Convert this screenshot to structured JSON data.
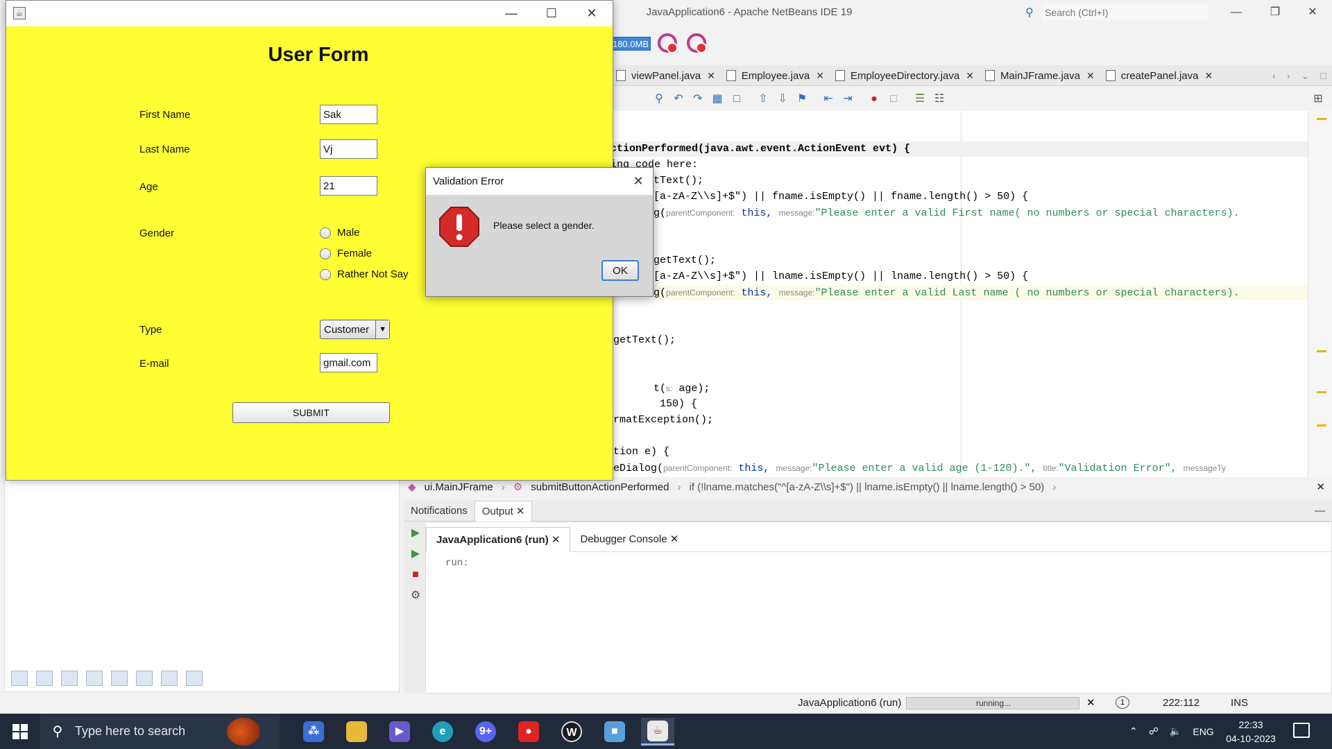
{
  "ide": {
    "title": "JavaApplication6 - Apache NetBeans IDE 19",
    "search_placeholder": "Search (Ctrl+I)",
    "memory": "180.0MB",
    "tabs": [
      {
        "label": "viewPanel.java"
      },
      {
        "label": "Employee.java"
      },
      {
        "label": "EmployeeDirectory.java"
      },
      {
        "label": "MainJFrame.java"
      },
      {
        "label": "createPanel.java"
      }
    ],
    "code_lines": [
      "ctionPerformed(java.awt.event.ActionEvent evt) {",
      "ing code here:",
      "tText();",
      "[a-zA-Z\\\\s]+$\") || fname.isEmpty() || fname.length() > 50) {",
      "g(",
      "parentComponent:",
      " this, ",
      "message:",
      "\"Please enter a valid First name( no numbers or special characters).",
      "getText();",
      "[a-zA-Z\\\\s]+$\") || lname.isEmpty() || lname.length() > 50) {",
      "\"Please enter a valid Last name ( no numbers or special characters).",
      "getText();",
      "t(",
      "s:",
      " age);",
      " 150) {",
      "rmatException();",
      "tion e) {",
      "eDialog(",
      "\"Please enter a valid age (1-120).\", ",
      "title:",
      "\"Validation Error\", ",
      "messageTy"
    ],
    "breadcrumb": [
      "ui.MainJFrame",
      "submitButtonActionPerformed",
      "if (!lname.matches(\"^[a-zA-Z\\\\s]+$\") || lname.isEmpty() || lname.length() > 50)"
    ],
    "output_tabs": [
      "Notifications",
      "Output"
    ],
    "output_subtabs": [
      "JavaApplication6 (run)",
      "Debugger Console"
    ],
    "output_text": "run:",
    "status": {
      "run_label": "JavaApplication6 (run)",
      "progress_label": "running...",
      "notif_count": "1",
      "position": "222:112",
      "mode": "INS"
    }
  },
  "form": {
    "title": "User Form",
    "labels": {
      "first_name": "First Name",
      "last_name": "Last Name",
      "age": "Age",
      "gender": "Gender",
      "type": "Type",
      "email": "E-mail"
    },
    "values": {
      "first_name": "Sak",
      "last_name": "Vj",
      "age": "21",
      "email": "gmail.com"
    },
    "gender_options": [
      "Male",
      "Female",
      "Rather Not Say"
    ],
    "type_selected": "Customer",
    "submit_label": "SUBMIT"
  },
  "dialog": {
    "title": "Validation Error",
    "message": "Please select a gender.",
    "ok_label": "OK"
  },
  "taskbar": {
    "search_placeholder": "Type here to search",
    "language": "ENG",
    "time": "22:33",
    "date": "04-10-2023",
    "chat_badge": "9+"
  },
  "colors": {
    "form_background": "#ffff33",
    "error_red": "#d42a2a",
    "taskbar": "#202a3a"
  }
}
